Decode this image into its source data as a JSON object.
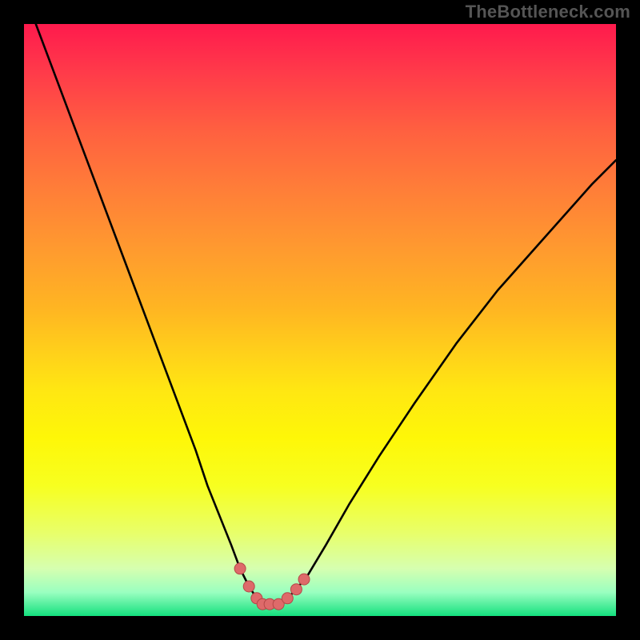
{
  "attribution": "TheBottleneck.com",
  "colors": {
    "page_bg": "#000000",
    "attribution_text": "#555555",
    "curve_stroke": "#000000",
    "marker_fill": "#de6a6a",
    "marker_stroke": "#b54848",
    "gradient_top": "#ff1a4d",
    "gradient_bottom": "#14e07e"
  },
  "chart_data": {
    "type": "line",
    "title": "",
    "xlabel": "",
    "ylabel": "",
    "xlim": [
      0,
      100
    ],
    "ylim": [
      0,
      100
    ],
    "grid": false,
    "legend": false,
    "series": [
      {
        "name": "bottleneck-curve",
        "x": [
          2,
          5,
          8,
          11,
          14,
          17,
          20,
          23,
          26,
          29,
          31,
          33,
          35,
          36.5,
          38,
          39.3,
          40.3,
          41.5,
          43,
          44.5,
          46,
          48,
          51,
          55,
          60,
          66,
          73,
          80,
          88,
          96,
          100
        ],
        "y": [
          100,
          92,
          84,
          76,
          68,
          60,
          52,
          44,
          36,
          28,
          22,
          17,
          12,
          8,
          5,
          3,
          2,
          2,
          2,
          3,
          4.5,
          7,
          12,
          19,
          27,
          36,
          46,
          55,
          64,
          73,
          77
        ]
      }
    ],
    "markers": {
      "name": "bottom-dots",
      "points": [
        {
          "x": 36.5,
          "y": 8
        },
        {
          "x": 38.0,
          "y": 5
        },
        {
          "x": 39.3,
          "y": 3
        },
        {
          "x": 40.3,
          "y": 2
        },
        {
          "x": 41.5,
          "y": 2
        },
        {
          "x": 43.0,
          "y": 2
        },
        {
          "x": 44.5,
          "y": 3
        },
        {
          "x": 46.0,
          "y": 4.5
        },
        {
          "x": 47.3,
          "y": 6.2
        }
      ],
      "radius_px": 7
    },
    "notes": "x and y are in percent of plot area; y=0 is bottom (green), y=100 is top (red). Values estimated from pixels."
  }
}
